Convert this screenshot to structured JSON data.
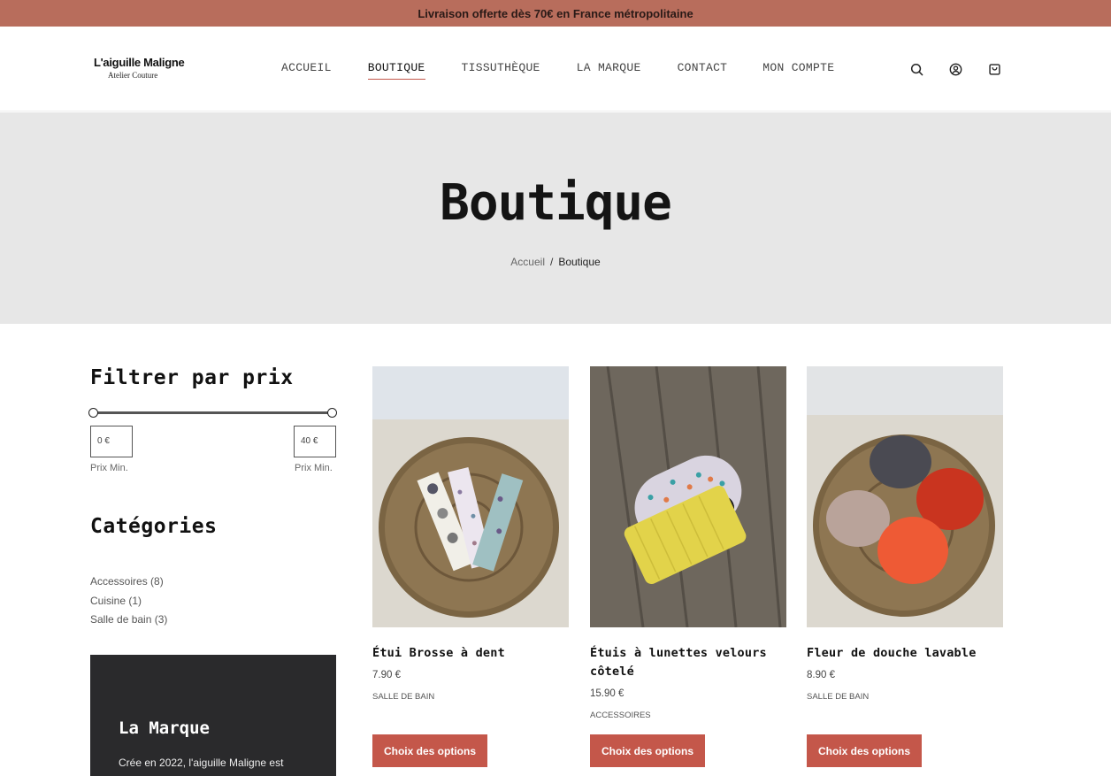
{
  "topbar": {
    "text": "Livraison offerte dès 70€ en France métropolitaine"
  },
  "logo": {
    "title": "L'aiguille Maligne",
    "subtitle": "Atelier Couture"
  },
  "nav": {
    "items": [
      {
        "label": "ACCUEIL"
      },
      {
        "label": "BOUTIQUE",
        "active": true
      },
      {
        "label": "TISSUTHÈQUE"
      },
      {
        "label": "LA MARQUE"
      },
      {
        "label": "CONTACT"
      },
      {
        "label": "MON COMPTE"
      }
    ]
  },
  "header_icons": [
    "search-icon",
    "account-icon",
    "cart-icon"
  ],
  "hero": {
    "title": "Boutique",
    "breadcrumb": {
      "home": "Accueil",
      "separator": "/",
      "current": "Boutique"
    }
  },
  "filter": {
    "title": "Filtrer par prix",
    "min_value": "0 €",
    "max_value": "40 €",
    "min_label": "Prix Min.",
    "max_label": "Prix Min."
  },
  "categories": {
    "title": "Catégories",
    "items": [
      {
        "label": "Accessoires (8)"
      },
      {
        "label": "Cuisine (1)"
      },
      {
        "label": "Salle de bain (3)"
      }
    ]
  },
  "marque": {
    "title": "La Marque",
    "text": "Crée en 2022, l'aiguille Maligne est"
  },
  "products": [
    {
      "name": "Étui Brosse à dent",
      "price": "7.90 €",
      "category": "SALLE DE BAIN",
      "button": "Choix des options"
    },
    {
      "name": "Étuis à lunettes velours côtelé",
      "price": "15.90 €",
      "category": "ACCESSOIRES",
      "button": "Choix des options"
    },
    {
      "name": "Fleur de douche lavable",
      "price": "8.90 €",
      "category": "SALLE DE BAIN",
      "button": "Choix des options"
    }
  ],
  "colors": {
    "topbar": "#b86d5c",
    "accent": "#c4574a",
    "hero_bg": "#e7e7e7",
    "dark_panel": "#2a2a2c"
  }
}
